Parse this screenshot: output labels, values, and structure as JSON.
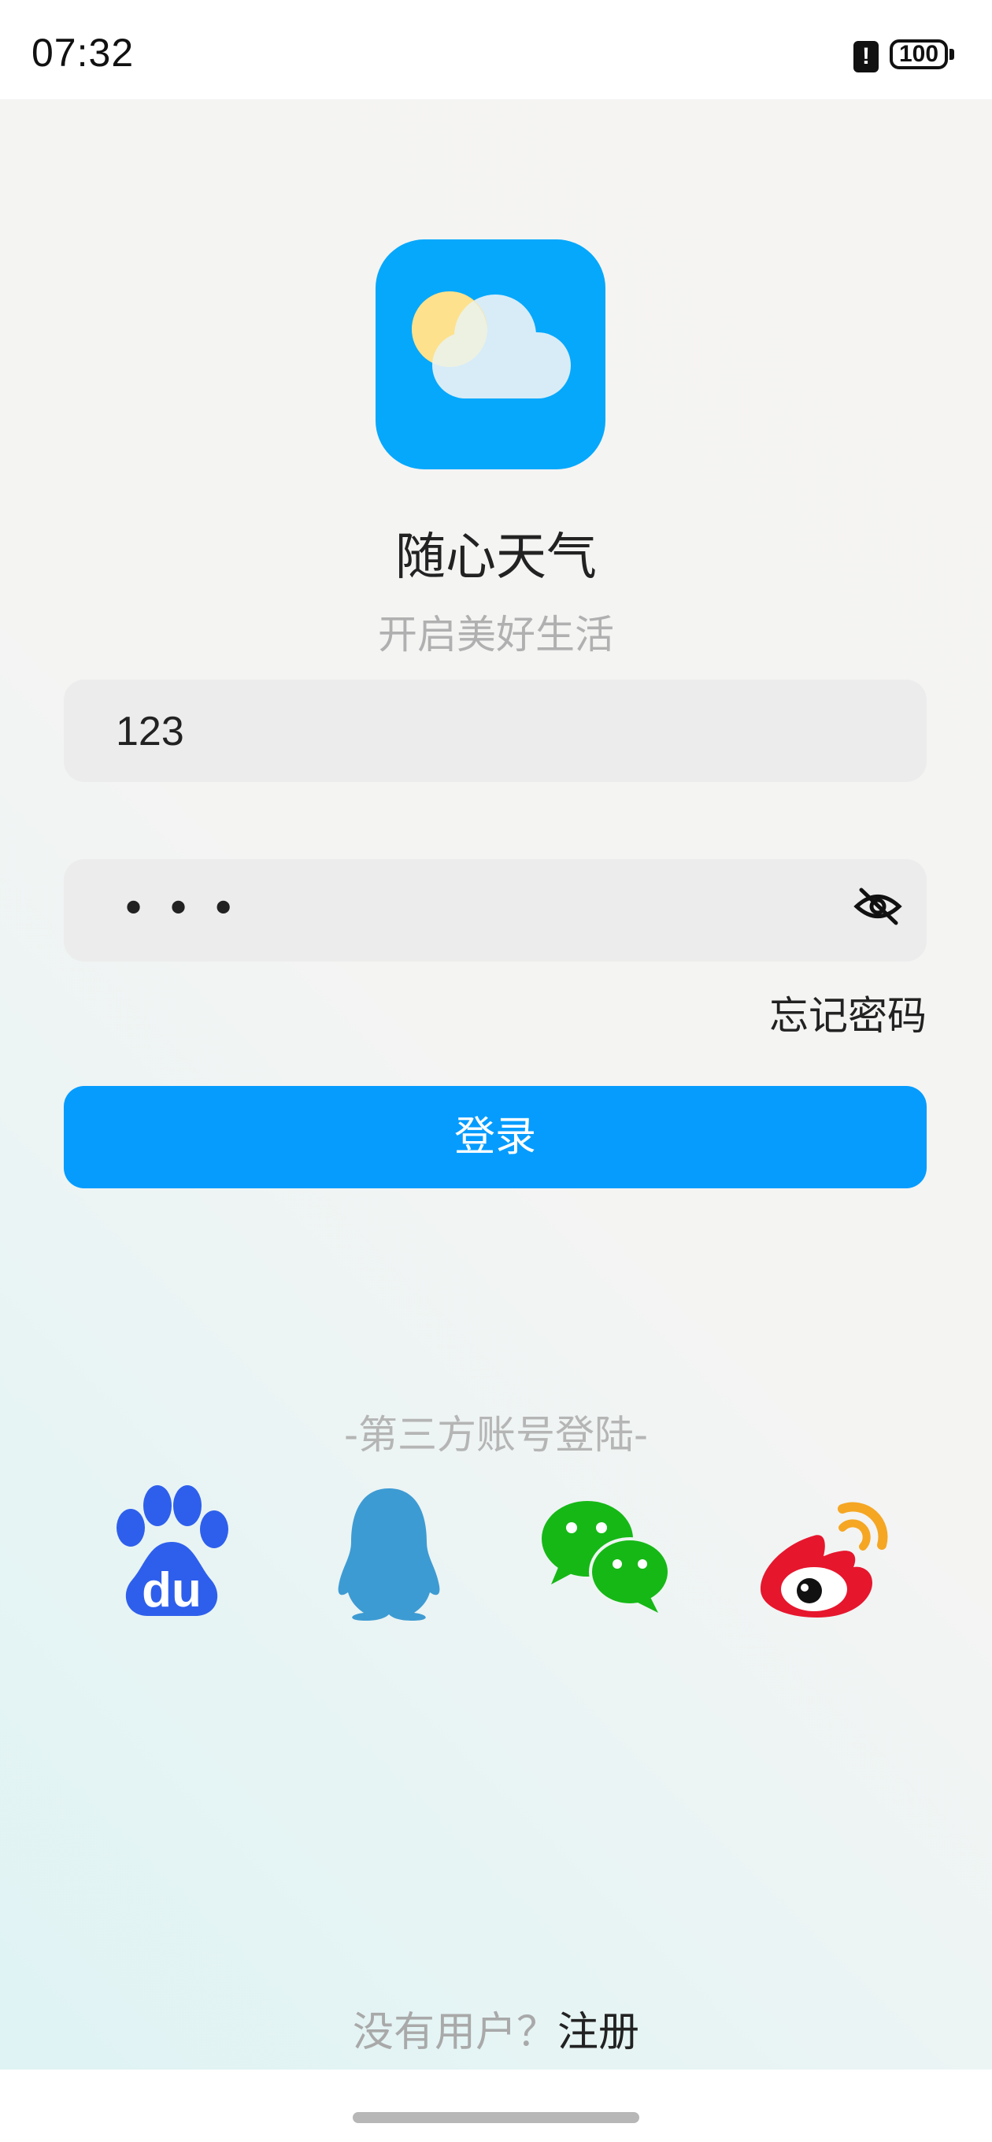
{
  "status_bar": {
    "time": "07:32",
    "alert_glyph": "!",
    "battery_level": "100"
  },
  "app": {
    "name": "随心天气",
    "slogan": "开启美好生活",
    "logo_icon": "sun-cloud-icon",
    "logo_color": "#06a8fb"
  },
  "form": {
    "username_value": "123",
    "password_masked": "•••",
    "password_visibility_icon": "eye-off-icon",
    "forgot_label": "忘记密码",
    "login_label": "登录",
    "accent_color": "#059cfe"
  },
  "third_party": {
    "title": "-第三方账号登陆-",
    "providers": [
      {
        "name": "baidu",
        "icon": "baidu-icon",
        "color": "#2e5fec"
      },
      {
        "name": "qq",
        "icon": "qq-penguin-icon",
        "color": "#3d9bd3"
      },
      {
        "name": "wechat",
        "icon": "wechat-icon",
        "color": "#16b816"
      },
      {
        "name": "weibo",
        "icon": "weibo-icon",
        "color": "#e6162d"
      }
    ]
  },
  "footer": {
    "no_account_text": "没有用户？",
    "register_label": "注册"
  }
}
